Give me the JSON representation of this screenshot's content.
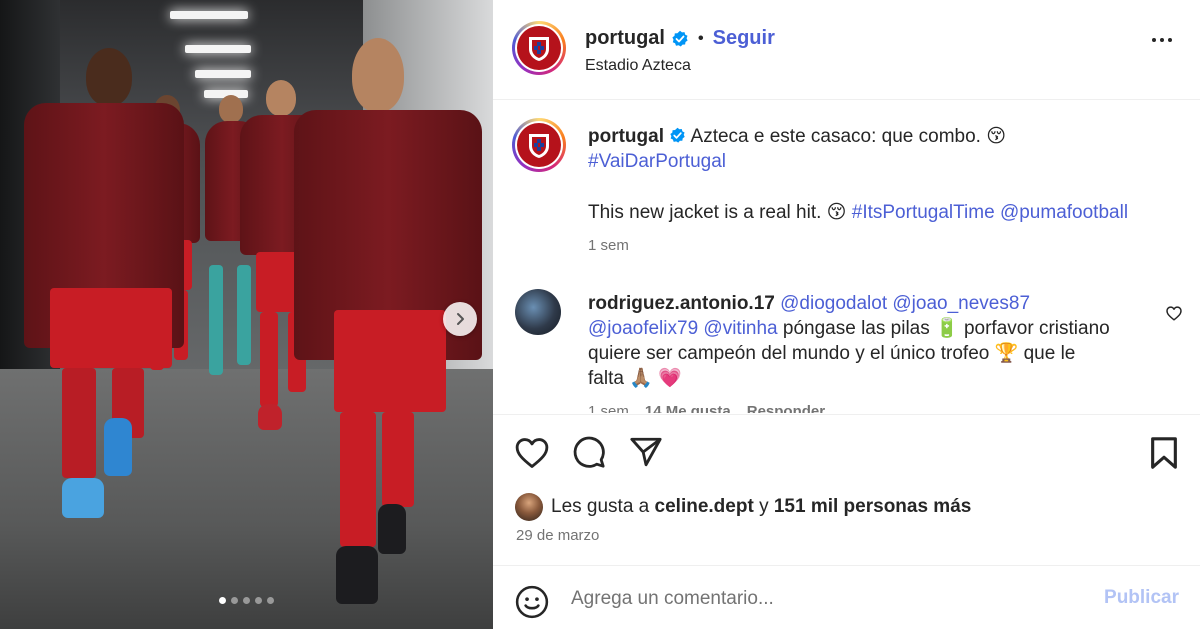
{
  "post": {
    "username": "portugal",
    "follow_label": "Seguir",
    "separator": "•",
    "location": "Estadio Azteca",
    "more_icon": "more-horizontal-icon"
  },
  "caption": {
    "username": "portugal",
    "text_1": "Azteca e este casaco: que combo.",
    "emoji_1": "😚",
    "hashtag_1": "#VaiDarPortugal",
    "text_2": "This new jacket is a real hit.",
    "emoji_2": "😚",
    "hashtag_2": "#ItsPortugalTime",
    "mention_1": "@pumafootball",
    "time": "1 sem"
  },
  "comments": [
    {
      "username": "rodriguez.antonio.17",
      "mentions_line1": "@diogodalot @joao_neves87",
      "mentions_line2": "@joaofelix79 @vitinha",
      "text_a": "póngase las pilas",
      "emoji_a": "🔋",
      "text_b": "porfavor cristiano",
      "text_c": "quiere ser campeón del mundo y el único trofeo",
      "emoji_b": "🏆",
      "text_d": "que le",
      "text_e": "falta",
      "emoji_c": "🙏🏽",
      "emoji_d": "💗",
      "time": "1 sem",
      "likes": "14 Me gusta",
      "reply": "Responder"
    }
  ],
  "actions": {
    "like_icon": "heart-icon",
    "comment_icon": "comment-icon",
    "share_icon": "send-icon",
    "save_icon": "bookmark-icon"
  },
  "likes": {
    "prefix": "Les gusta a",
    "user": "celine.dept",
    "connector": "y",
    "count_text": "151 mil personas más"
  },
  "date": "29 de marzo",
  "composer": {
    "placeholder": "Agrega un comentario...",
    "publish_label": "Publicar"
  },
  "carousel": {
    "total": 5,
    "active": 1
  },
  "colors": {
    "link": "#4c5fd5",
    "verified": "#0095f6",
    "publish_disabled": "#b2c3f5",
    "crest_red": "#b5121b"
  }
}
